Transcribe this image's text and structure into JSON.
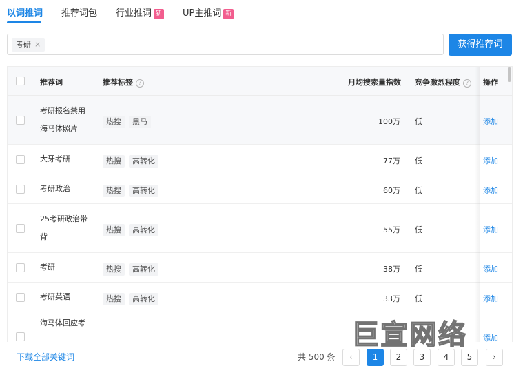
{
  "tabs": [
    {
      "label": "以词推词",
      "active": true,
      "new_badge": false
    },
    {
      "label": "推荐词包",
      "active": false,
      "new_badge": false
    },
    {
      "label": "行业推词",
      "active": false,
      "new_badge": true
    },
    {
      "label": "UP主推词",
      "active": false,
      "new_badge": true
    }
  ],
  "new_badge_label": "新",
  "search": {
    "chip": "考研",
    "chip_close": "×",
    "button": "获得推荐词"
  },
  "table": {
    "headers": {
      "keyword": "推荐词",
      "tags": "推荐标签",
      "monthly_search": "月均搜索量指数",
      "competition": "竞争激烈程度",
      "action": "操作"
    },
    "help_glyph": "?",
    "rows": [
      {
        "keyword": "考研报名禁用海马体照片",
        "tags": [
          "热搜",
          "黑马"
        ],
        "monthly_search": "100万",
        "competition": "低",
        "action": "添加"
      },
      {
        "keyword": "大牙考研",
        "tags": [
          "热搜",
          "高转化"
        ],
        "monthly_search": "77万",
        "competition": "低",
        "action": "添加"
      },
      {
        "keyword": "考研政治",
        "tags": [
          "热搜",
          "高转化"
        ],
        "monthly_search": "60万",
        "competition": "低",
        "action": "添加"
      },
      {
        "keyword": "25考研政治带背",
        "tags": [
          "热搜",
          "高转化"
        ],
        "monthly_search": "55万",
        "competition": "低",
        "action": "添加"
      },
      {
        "keyword": "考研",
        "tags": [
          "热搜",
          "高转化"
        ],
        "monthly_search": "38万",
        "competition": "低",
        "action": "添加"
      },
      {
        "keyword": "考研英语",
        "tags": [
          "热搜",
          "高转化"
        ],
        "monthly_search": "33万",
        "competition": "低",
        "action": "添加"
      },
      {
        "keyword": "海马体回应考",
        "tags": [],
        "monthly_search": "",
        "competition": "",
        "action": "添加"
      }
    ]
  },
  "footer": {
    "download": "下载全部关键词",
    "total": "共 500 条",
    "prev": "‹",
    "next": "›",
    "pages": [
      "1",
      "2",
      "3",
      "4",
      "5"
    ],
    "current_page": 1
  },
  "watermark": "巨宣网络",
  "colors": {
    "accent": "#1d86e6",
    "new_badge": "#f25d8e"
  }
}
